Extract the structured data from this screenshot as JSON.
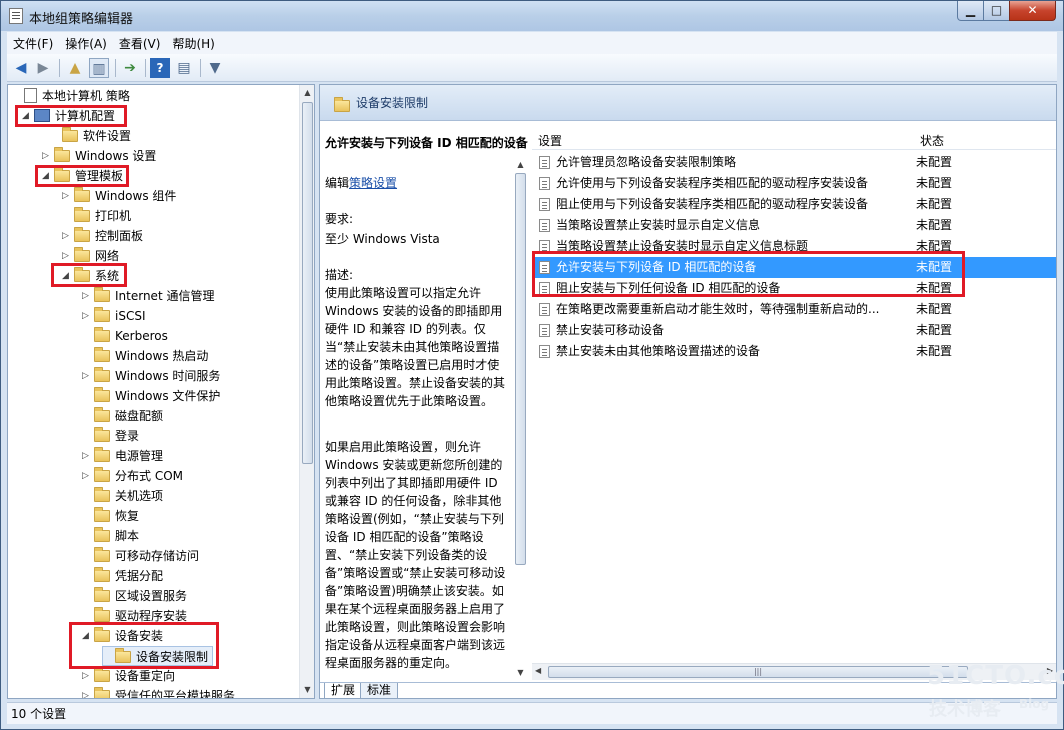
{
  "window": {
    "title": "本地组策略编辑器",
    "min": "▁",
    "max": "□",
    "close": "✕"
  },
  "menu": [
    "文件(F)",
    "操作(A)",
    "查看(V)",
    "帮助(H)"
  ],
  "toolbar_icons": [
    "back-icon",
    "forward-icon",
    "up-folder-icon",
    "show-hide-tree-icon",
    "export-list-icon",
    "help-icon",
    "properties-icon",
    "filter-icon"
  ],
  "tree": [
    {
      "label": "本地计算机 策略",
      "kind": "doc",
      "arrow": ""
    },
    {
      "label": "计算机配置",
      "kind": "pc",
      "arrow": "◢"
    },
    {
      "label": "软件设置",
      "kind": "folder",
      "arrow": ""
    },
    {
      "label": "Windows 设置",
      "kind": "folder",
      "arrow": "▷"
    },
    {
      "label": "管理模板",
      "kind": "folder",
      "arrow": "◢"
    },
    {
      "label": "Windows 组件",
      "kind": "folder",
      "arrow": "▷"
    },
    {
      "label": "打印机",
      "kind": "folder",
      "arrow": ""
    },
    {
      "label": "控制面板",
      "kind": "folder",
      "arrow": "▷"
    },
    {
      "label": "网络",
      "kind": "folder",
      "arrow": "▷"
    },
    {
      "label": "系统",
      "kind": "folder",
      "arrow": "◢"
    },
    {
      "label": "Internet 通信管理",
      "kind": "folder",
      "arrow": "▷"
    },
    {
      "label": "iSCSI",
      "kind": "folder",
      "arrow": "▷"
    },
    {
      "label": "Kerberos",
      "kind": "folder",
      "arrow": ""
    },
    {
      "label": "Windows 热启动",
      "kind": "folder",
      "arrow": ""
    },
    {
      "label": "Windows 时间服务",
      "kind": "folder",
      "arrow": "▷"
    },
    {
      "label": "Windows 文件保护",
      "kind": "folder",
      "arrow": ""
    },
    {
      "label": "磁盘配额",
      "kind": "folder",
      "arrow": ""
    },
    {
      "label": "登录",
      "kind": "folder",
      "arrow": ""
    },
    {
      "label": "电源管理",
      "kind": "folder",
      "arrow": "▷"
    },
    {
      "label": "分布式 COM",
      "kind": "folder",
      "arrow": "▷"
    },
    {
      "label": "关机选项",
      "kind": "folder",
      "arrow": ""
    },
    {
      "label": "恢复",
      "kind": "folder",
      "arrow": ""
    },
    {
      "label": "脚本",
      "kind": "folder",
      "arrow": ""
    },
    {
      "label": "可移动存储访问",
      "kind": "folder",
      "arrow": ""
    },
    {
      "label": "凭据分配",
      "kind": "folder",
      "arrow": ""
    },
    {
      "label": "区域设置服务",
      "kind": "folder",
      "arrow": ""
    },
    {
      "label": "驱动程序安装",
      "kind": "folder",
      "arrow": ""
    },
    {
      "label": "设备安装",
      "kind": "folder",
      "arrow": "◢"
    },
    {
      "label": "设备安装限制",
      "kind": "folder",
      "arrow": ""
    },
    {
      "label": "设备重定向",
      "kind": "folder",
      "arrow": "▷"
    },
    {
      "label": "受信任的平台模块服务",
      "kind": "folder",
      "arrow": "▷"
    }
  ],
  "right": {
    "header": "设备安装限制",
    "desc": {
      "title": "允许安装与下列设备 ID 相匹配的设备",
      "edit_prefix": "编辑",
      "edit_link": "策略设置",
      "req_label": "要求:",
      "req_value": "至少 Windows Vista",
      "desc_label": "描述:",
      "para1": "使用此策略设置可以指定允许 Windows 安装的设备的即插即用硬件 ID 和兼容 ID 的列表。仅当“禁止安装未由其他策略设置描述的设备”策略设置已启用时才使用此策略设置。禁止设备安装的其他策略设置优先于此策略设置。",
      "para2": "如果启用此策略设置，则允许 Windows 安装或更新您所创建的列表中列出了其即插即用硬件 ID 或兼容 ID 的任何设备，除非其他策略设置(例如，“禁止安装与下列设备 ID 相匹配的设备”策略设置、“禁止安装下列设备类的设备”策略设置或“禁止安装可移动设备”策略设置)明确禁止该安装。如果在某个远程桌面服务器上启用了此策略设置，则此策略设置会影响指定设备从远程桌面客户端到该远程桌面服务器的重定向。"
    },
    "columns": {
      "setting": "设置",
      "state": "状态"
    },
    "rows": [
      {
        "name": "允许管理员忽略设备安装限制策略",
        "state": "未配置"
      },
      {
        "name": "允许使用与下列设备安装程序类相匹配的驱动程序安装设备",
        "state": "未配置"
      },
      {
        "name": "阻止使用与下列设备安装程序类相匹配的驱动程序安装设备",
        "state": "未配置"
      },
      {
        "name": "当策略设置禁止安装时显示自定义信息",
        "state": "未配置"
      },
      {
        "name": "当策略设置禁止设备安装时显示自定义信息标题",
        "state": "未配置"
      },
      {
        "name": "允许安装与下列设备 ID 相匹配的设备",
        "state": "未配置"
      },
      {
        "name": "阻止安装与下列任何设备 ID 相匹配的设备",
        "state": "未配置"
      },
      {
        "name": "在策略更改需要重新启动才能生效时，等待强制重新启动的...",
        "state": "未配置"
      },
      {
        "name": "禁止安装可移动设备",
        "state": "未配置"
      },
      {
        "name": "禁止安装未由其他策略设置描述的设备",
        "state": "未配置"
      }
    ],
    "tabs": [
      "扩展",
      "标准"
    ]
  },
  "status": "10 个设置",
  "watermark": {
    "main": "51CTO.com",
    "sub": "技术博客",
    "blog": "Blog"
  },
  "colors": {
    "selection": "#3399ff",
    "highlight_box": "#e01a26"
  }
}
